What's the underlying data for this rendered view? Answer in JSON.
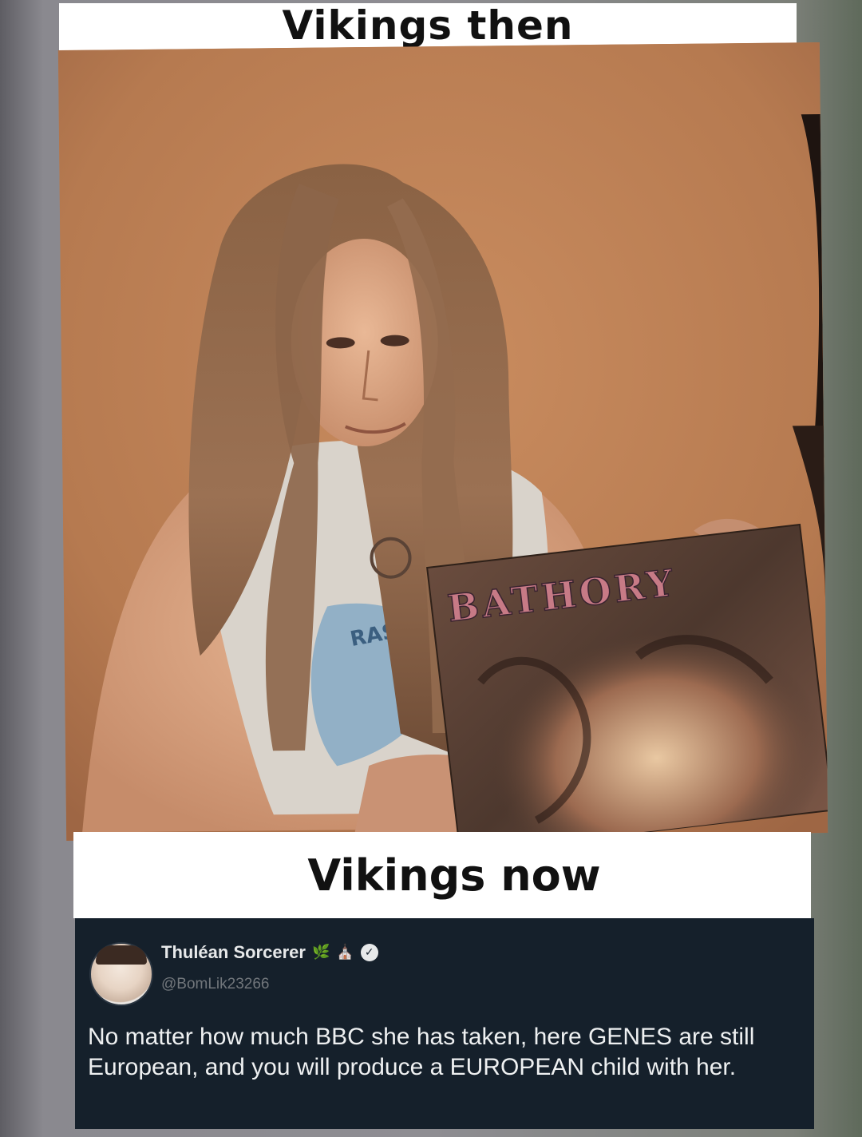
{
  "meme": {
    "caption_top": "Vikings then",
    "caption_bottom": "Vikings now"
  },
  "photo": {
    "album_text": "BATHORY",
    "shirt_text": "RASH"
  },
  "tweet": {
    "display_name": "Thuléan Sorcerer",
    "badges": [
      "🌿",
      "⛪"
    ],
    "verified_icon": "check-badge-icon",
    "handle": "@BomLik23266",
    "text": "No matter how much BBC she has taken, here GENES are still European, and you will produce a EUROPEAN child with her.",
    "colors": {
      "background": "#15202b",
      "text": "#e7e9ea",
      "muted": "#71767b"
    }
  }
}
